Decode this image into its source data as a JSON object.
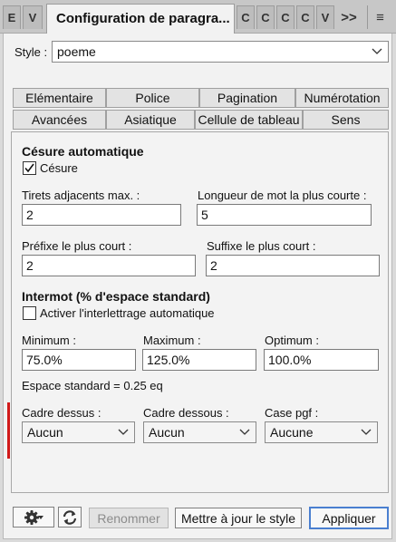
{
  "tab_strip": {
    "mini_tabs_left": [
      "E",
      "V"
    ],
    "active_tab": "Configuration de paragra...",
    "mini_tabs_right": [
      "C",
      "C",
      "C",
      "C",
      "V"
    ],
    "overflow": ">>",
    "menu": "≡"
  },
  "style_row": {
    "label": "Style :",
    "value": "poeme"
  },
  "dialog_tabs": {
    "row1": [
      "Elémentaire",
      "Police",
      "Pagination",
      "Numérotation"
    ],
    "row2": [
      "Avancées",
      "Asiatique",
      "Cellule de tableau",
      "Sens"
    ]
  },
  "cesure": {
    "heading": "Césure automatique",
    "checkbox_label": "Césure",
    "checked": true,
    "max_hyphens_label": "Tirets adjacents max. :",
    "max_hyphens_value": "2",
    "min_word_label": "Longueur de mot la plus courte :",
    "min_word_value": "5",
    "prefix_label": "Préfixe le plus court :",
    "prefix_value": "2",
    "suffix_label": "Suffixe le plus court :",
    "suffix_value": "2"
  },
  "intermot": {
    "heading": "Intermot (% d'espace standard)",
    "checkbox_label": "Activer l'interlettrage automatique",
    "checked": false,
    "minimum_label": "Minimum :",
    "minimum_value": "75.0%",
    "maximum_label": "Maximum :",
    "maximum_value": "125.0%",
    "optimum_label": "Optimum :",
    "optimum_value": "100.0%",
    "standard_space": "Espace standard = 0.25 eq"
  },
  "frames": {
    "top_label": "Cadre dessus :",
    "top_value": "Aucun",
    "bottom_label": "Cadre dessous :",
    "bottom_value": "Aucun",
    "box_label": "Case pgf :",
    "box_value": "Aucune"
  },
  "footer": {
    "rename": "Renommer",
    "update_style": "Mettre à jour le style",
    "apply": "Appliquer"
  },
  "colors": {
    "accent_marker": "#d11a1a",
    "apply_border": "#4a7fd0"
  },
  "icons": [
    "gear-icon",
    "dropdown-arrow-icon",
    "refresh-icon",
    "chevron-down-icon",
    "menu-icon",
    "checkmark-icon"
  ]
}
